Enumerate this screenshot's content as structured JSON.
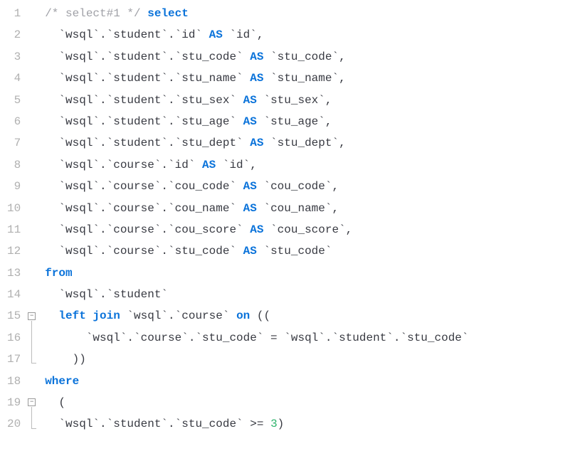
{
  "code": {
    "lines": [
      {
        "n": "1",
        "indent": 0,
        "fold": null,
        "tokens": [
          {
            "t": "/* select#1 */ ",
            "c": "comment"
          },
          {
            "t": "select",
            "c": "kw"
          }
        ]
      },
      {
        "n": "2",
        "indent": 1,
        "fold": null,
        "tokens": [
          {
            "t": "`wsql`.`student`.`id` ",
            "c": "plain"
          },
          {
            "t": "AS",
            "c": "kw"
          },
          {
            "t": " `id`,",
            "c": "plain"
          }
        ]
      },
      {
        "n": "3",
        "indent": 1,
        "fold": null,
        "tokens": [
          {
            "t": "`wsql`.`student`.`stu_code` ",
            "c": "plain"
          },
          {
            "t": "AS",
            "c": "kw"
          },
          {
            "t": " `stu_code`,",
            "c": "plain"
          }
        ]
      },
      {
        "n": "4",
        "indent": 1,
        "fold": null,
        "tokens": [
          {
            "t": "`wsql`.`student`.`stu_name` ",
            "c": "plain"
          },
          {
            "t": "AS",
            "c": "kw"
          },
          {
            "t": " `stu_name`,",
            "c": "plain"
          }
        ]
      },
      {
        "n": "5",
        "indent": 1,
        "fold": null,
        "tokens": [
          {
            "t": "`wsql`.`student`.`stu_sex` ",
            "c": "plain"
          },
          {
            "t": "AS",
            "c": "kw"
          },
          {
            "t": " `stu_sex`,",
            "c": "plain"
          }
        ]
      },
      {
        "n": "6",
        "indent": 1,
        "fold": null,
        "tokens": [
          {
            "t": "`wsql`.`student`.`stu_age` ",
            "c": "plain"
          },
          {
            "t": "AS",
            "c": "kw"
          },
          {
            "t": " `stu_age`,",
            "c": "plain"
          }
        ]
      },
      {
        "n": "7",
        "indent": 1,
        "fold": null,
        "tokens": [
          {
            "t": "`wsql`.`student`.`stu_dept` ",
            "c": "plain"
          },
          {
            "t": "AS",
            "c": "kw"
          },
          {
            "t": " `stu_dept`,",
            "c": "plain"
          }
        ]
      },
      {
        "n": "8",
        "indent": 1,
        "fold": null,
        "tokens": [
          {
            "t": "`wsql`.`course`.`id` ",
            "c": "plain"
          },
          {
            "t": "AS",
            "c": "kw"
          },
          {
            "t": " `id`,",
            "c": "plain"
          }
        ]
      },
      {
        "n": "9",
        "indent": 1,
        "fold": null,
        "tokens": [
          {
            "t": "`wsql`.`course`.`cou_code` ",
            "c": "plain"
          },
          {
            "t": "AS",
            "c": "kw"
          },
          {
            "t": " `cou_code`,",
            "c": "plain"
          }
        ]
      },
      {
        "n": "10",
        "indent": 1,
        "fold": null,
        "tokens": [
          {
            "t": "`wsql`.`course`.`cou_name` ",
            "c": "plain"
          },
          {
            "t": "AS",
            "c": "kw"
          },
          {
            "t": " `cou_name`,",
            "c": "plain"
          }
        ]
      },
      {
        "n": "11",
        "indent": 1,
        "fold": null,
        "tokens": [
          {
            "t": "`wsql`.`course`.`cou_score` ",
            "c": "plain"
          },
          {
            "t": "AS",
            "c": "kw"
          },
          {
            "t": " `cou_score`,",
            "c": "plain"
          }
        ]
      },
      {
        "n": "12",
        "indent": 1,
        "fold": null,
        "tokens": [
          {
            "t": "`wsql`.`course`.`stu_code` ",
            "c": "plain"
          },
          {
            "t": "AS",
            "c": "kw"
          },
          {
            "t": " `stu_code`",
            "c": "plain"
          }
        ]
      },
      {
        "n": "13",
        "indent": 0,
        "fold": null,
        "tokens": [
          {
            "t": "from",
            "c": "kw"
          }
        ]
      },
      {
        "n": "14",
        "indent": 1,
        "fold": null,
        "tokens": [
          {
            "t": "`wsql`.`student`",
            "c": "plain"
          }
        ]
      },
      {
        "n": "15",
        "indent": 1,
        "fold": "open",
        "tokens": [
          {
            "t": "left join",
            "c": "kw"
          },
          {
            "t": " `wsql`.`course` ",
            "c": "plain"
          },
          {
            "t": "on",
            "c": "kw"
          },
          {
            "t": " ((",
            "c": "plain"
          }
        ]
      },
      {
        "n": "16",
        "indent": 3,
        "fold": "mid",
        "tokens": [
          {
            "t": "`wsql`.`course`.`stu_code` = `wsql`.`student`.`stu_code`",
            "c": "plain"
          }
        ]
      },
      {
        "n": "17",
        "indent": 2,
        "fold": "end",
        "tokens": [
          {
            "t": "))",
            "c": "plain"
          }
        ]
      },
      {
        "n": "18",
        "indent": 0,
        "fold": null,
        "tokens": [
          {
            "t": "where",
            "c": "kw"
          }
        ]
      },
      {
        "n": "19",
        "indent": 1,
        "fold": "open",
        "tokens": [
          {
            "t": "(",
            "c": "plain"
          }
        ]
      },
      {
        "n": "20",
        "indent": 1,
        "fold": "mid",
        "tokens": [
          {
            "t": "`wsql`.`student`.`stu_code` >= ",
            "c": "plain"
          },
          {
            "t": "3",
            "c": "num"
          },
          {
            "t": ")",
            "c": "plain"
          }
        ]
      }
    ],
    "fold_glyph": "−",
    "indent_unit": "  "
  }
}
